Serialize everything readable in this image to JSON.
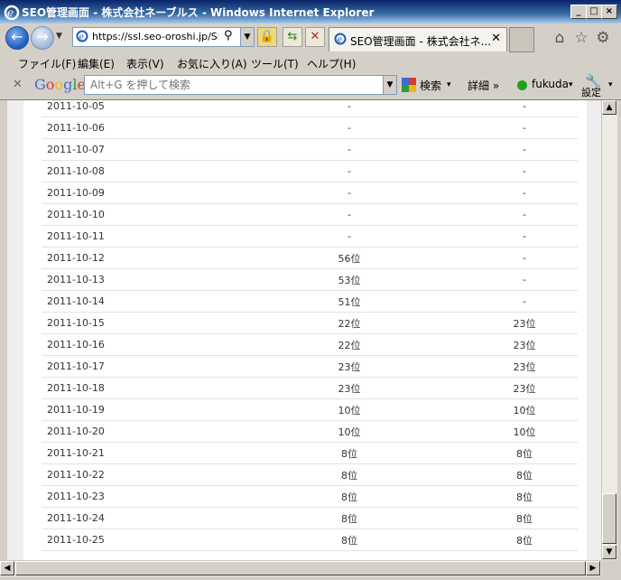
{
  "window": {
    "title": "SEO管理画面 - 株式会社ネーブルス - Windows Internet Explorer"
  },
  "nav": {
    "url": "https://ssl.seo-oroshi.jp/SE",
    "tab_title": "SEO管理画面 - 株式会社ネ..."
  },
  "menu": {
    "items": [
      "ファイル(F)",
      "編集(E)",
      "表示(V)",
      "お気に入り(A)",
      "ツール(T)",
      "ヘルプ(H)"
    ]
  },
  "google_bar": {
    "logo": "Google",
    "search_placeholder": "Alt+G を押して検索",
    "search_label": "検索",
    "details_label": "詳細 »",
    "user_label": "fukuda",
    "settings_label": "設定"
  },
  "colors": {
    "title_gradient_start": "#0a246a",
    "ie_blue": "#1d5bbf",
    "status_green": "#1aa31a"
  },
  "rankings": {
    "rows": [
      {
        "date": "2011-10-05",
        "a": "-",
        "b": "-"
      },
      {
        "date": "2011-10-06",
        "a": "-",
        "b": "-"
      },
      {
        "date": "2011-10-07",
        "a": "-",
        "b": "-"
      },
      {
        "date": "2011-10-08",
        "a": "-",
        "b": "-"
      },
      {
        "date": "2011-10-09",
        "a": "-",
        "b": "-"
      },
      {
        "date": "2011-10-10",
        "a": "-",
        "b": "-"
      },
      {
        "date": "2011-10-11",
        "a": "-",
        "b": "-"
      },
      {
        "date": "2011-10-12",
        "a": "56位",
        "b": "-"
      },
      {
        "date": "2011-10-13",
        "a": "53位",
        "b": "-"
      },
      {
        "date": "2011-10-14",
        "a": "51位",
        "b": "-"
      },
      {
        "date": "2011-10-15",
        "a": "22位",
        "b": "23位"
      },
      {
        "date": "2011-10-16",
        "a": "22位",
        "b": "23位"
      },
      {
        "date": "2011-10-17",
        "a": "23位",
        "b": "23位"
      },
      {
        "date": "2011-10-18",
        "a": "23位",
        "b": "23位"
      },
      {
        "date": "2011-10-19",
        "a": "10位",
        "b": "10位"
      },
      {
        "date": "2011-10-20",
        "a": "10位",
        "b": "10位"
      },
      {
        "date": "2011-10-21",
        "a": "8位",
        "b": "8位"
      },
      {
        "date": "2011-10-22",
        "a": "8位",
        "b": "8位"
      },
      {
        "date": "2011-10-23",
        "a": "8位",
        "b": "8位"
      },
      {
        "date": "2011-10-24",
        "a": "8位",
        "b": "8位"
      },
      {
        "date": "2011-10-25",
        "a": "8位",
        "b": "8位"
      }
    ]
  }
}
